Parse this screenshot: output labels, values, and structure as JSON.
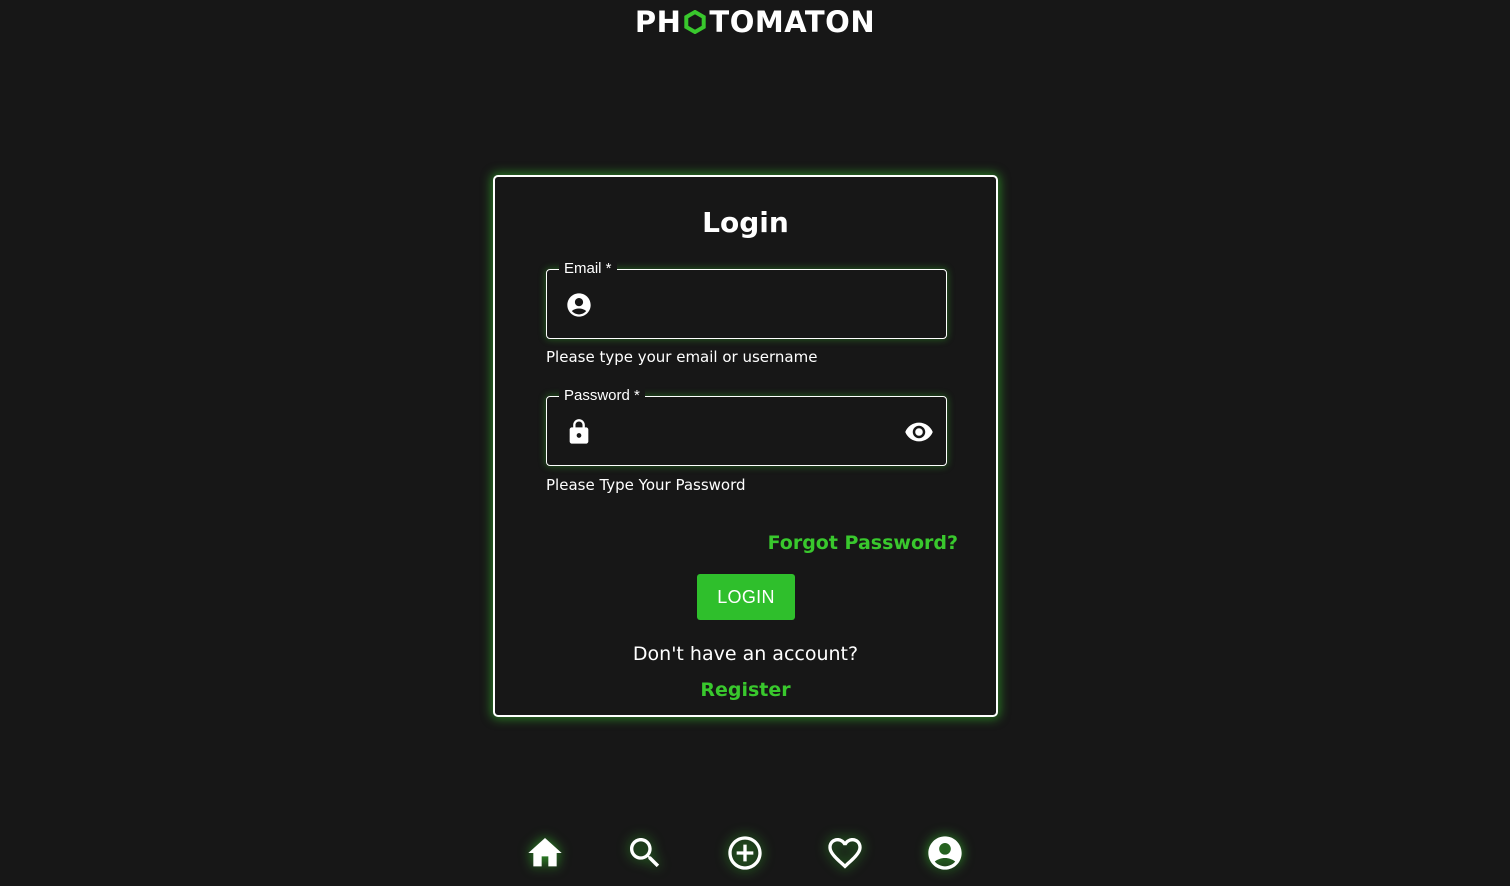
{
  "app": {
    "logo_text": [
      "PH",
      "TOMATON"
    ],
    "logo_ring_color": "#39c82d"
  },
  "colors": {
    "accent": "#39c82d",
    "button_bg": "#2fbf2c",
    "background": "#171717",
    "text": "#ffffff"
  },
  "login": {
    "title": "Login",
    "email_label": "Email *",
    "email_value": "",
    "email_helper": "Please type your email or username",
    "password_label": "Password *",
    "password_value": "",
    "password_helper": "Please Type Your Password",
    "forgot_password": "Forgot Password?",
    "login_button": "LOGIN",
    "no_account_text": "Don't have an account?",
    "register_link": "Register"
  },
  "icons": {
    "email_icon": "account-circle-icon",
    "password_icon": "lock-icon",
    "password_toggle": "eye-icon"
  },
  "bottom_nav": [
    {
      "name": "home",
      "icon": "home-icon"
    },
    {
      "name": "search",
      "icon": "search-icon"
    },
    {
      "name": "add",
      "icon": "add-circle-icon"
    },
    {
      "name": "favorites",
      "icon": "heart-icon"
    },
    {
      "name": "profile",
      "icon": "account-circle-icon"
    }
  ]
}
